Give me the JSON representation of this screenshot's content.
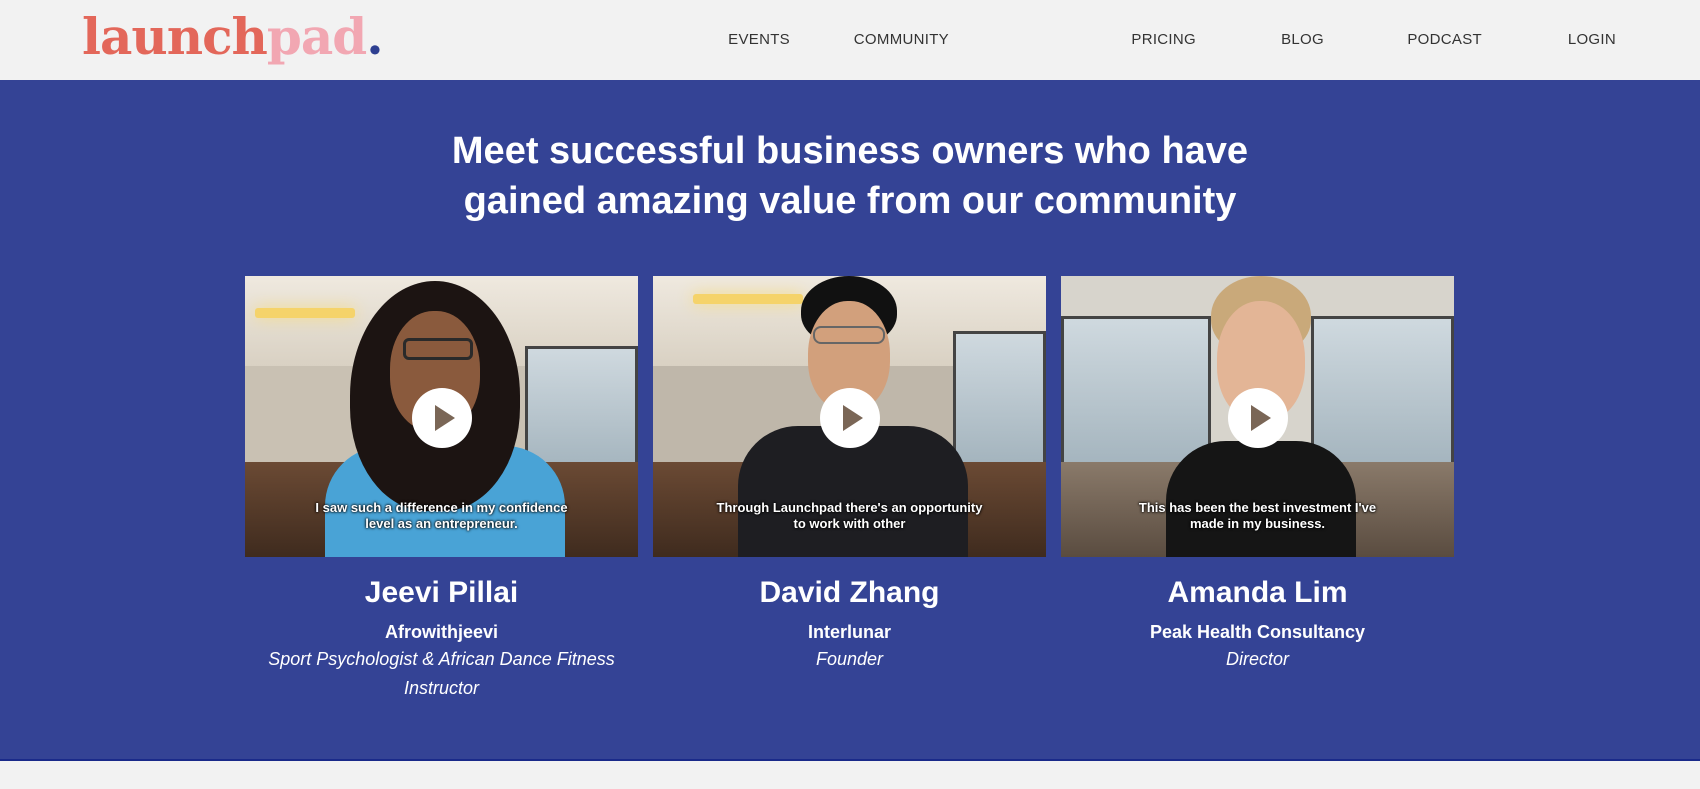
{
  "brand": {
    "part1": "launch",
    "part2": "pad",
    "dot": "."
  },
  "nav": {
    "items": [
      {
        "label": "EVENTS"
      },
      {
        "label": "COMMUNITY"
      },
      {
        "label": "PRICING"
      },
      {
        "label": "BLOG"
      },
      {
        "label": "PODCAST"
      },
      {
        "label": "LOGIN"
      }
    ]
  },
  "hero": {
    "headline_line1": "Meet successful business owners who have",
    "headline_line2": "gained amazing value from our community",
    "testimonials": [
      {
        "caption": "I saw such a difference in my confidence level as an entrepreneur.",
        "name": "Jeevi Pillai",
        "company": "Afrowithjeevi",
        "role": "Sport Psychologist & African Dance Fitness Instructor"
      },
      {
        "caption": "Through Launchpad there's an opportunity to work with other",
        "name": "David Zhang",
        "company": "Interlunar",
        "role": "Founder"
      },
      {
        "caption": "This has been the best investment I've made in my business.",
        "name": "Amanda Lim",
        "company": "Peak Health Consultancy",
        "role": "Director"
      }
    ]
  },
  "colors": {
    "brand_coral": "#e3675a",
    "brand_pink": "#f2a7b2",
    "hero_blue": "#344395"
  },
  "icons": {
    "play": "play-icon"
  }
}
